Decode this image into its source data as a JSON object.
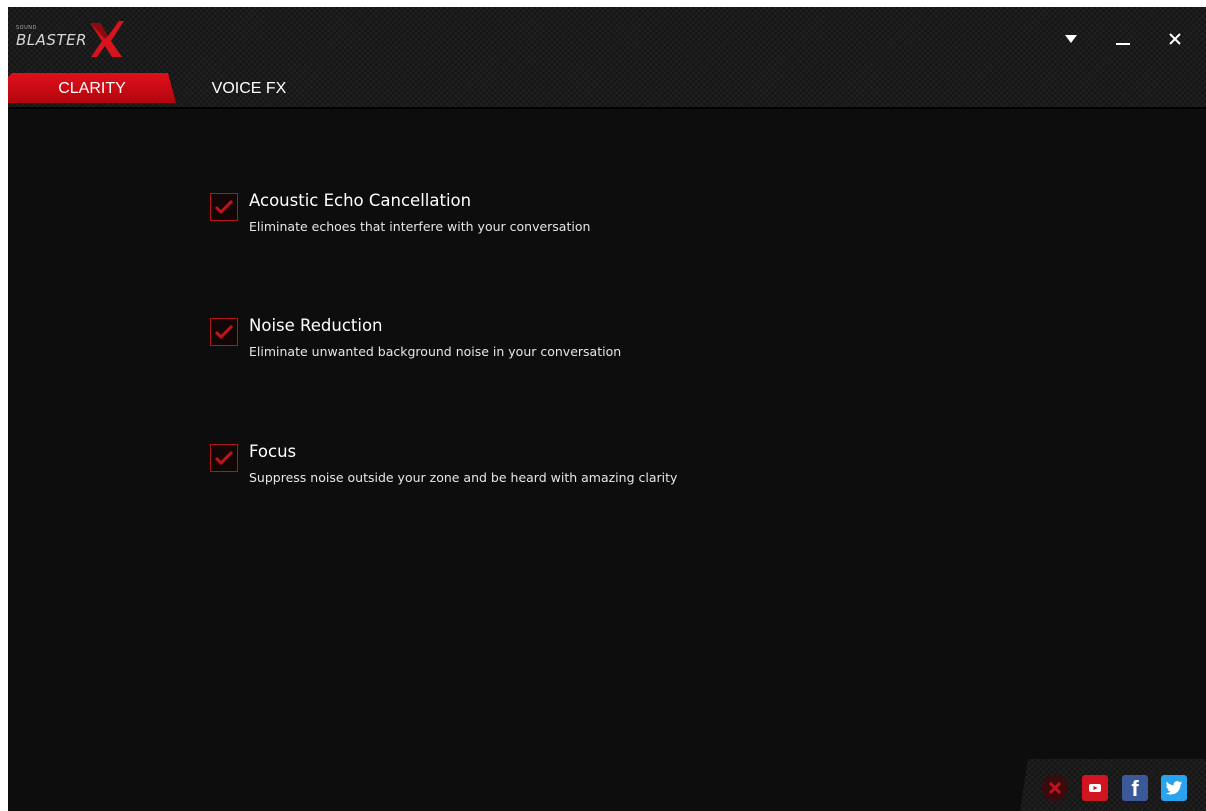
{
  "app": {
    "logo_small": "SOUND",
    "logo_text": "BLASTER",
    "brand_accent": "#e0101a"
  },
  "tabs": [
    {
      "label": "CLARITY",
      "active": true
    },
    {
      "label": "VOICE FX",
      "active": false
    }
  ],
  "options": [
    {
      "title": "Acoustic Echo Cancellation",
      "description": "Eliminate echoes that interfere with your conversation",
      "checked": true
    },
    {
      "title": "Noise Reduction",
      "description": "Eliminate unwanted background noise in your conversation",
      "checked": true
    },
    {
      "title": "Focus",
      "description": "Suppress noise outside your zone and be heard with amazing clarity",
      "checked": true
    }
  ],
  "window_controls": [
    "dropdown-icon",
    "minimize-icon",
    "close-icon"
  ],
  "social_links": [
    "blasterx-icon",
    "youtube-icon",
    "facebook-icon",
    "twitter-icon"
  ]
}
